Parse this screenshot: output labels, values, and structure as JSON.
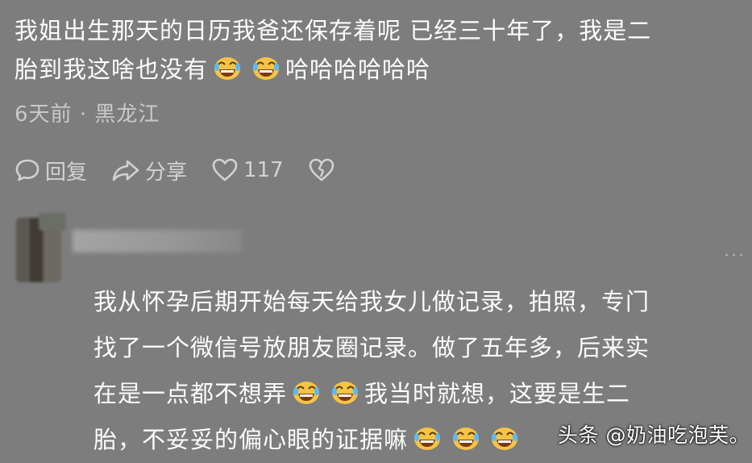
{
  "comment": {
    "text_line1": "我姐出生那天的日历我爸还保存着呢 已经三十年了，我是二",
    "text_line2_before": "胎到我这啥也没有",
    "text_line2_after": "哈哈哈哈哈哈",
    "time": "6天前",
    "separator": "·",
    "location": "黑龙江"
  },
  "actions": {
    "reply_label": "回复",
    "share_label": "分享",
    "like_count": "117"
  },
  "reply": {
    "line1": "我从怀孕后期开始每天给我女儿做记录，拍照，专门",
    "line2": "找了一个微信号放朋友圈记录。做了五年多，后来实",
    "line3_before": "在是一点都不想弄",
    "line3_after": "我当时就想，这要是生二",
    "line4": "胎，不妥妥的偏心眼的证据嘛",
    "more": "···"
  },
  "watermark": "头条 @奶油吃泡芙。",
  "colors": {
    "background": "#7d7d7d",
    "text": "#fdfdfd",
    "secondary": "#c9c9c9",
    "emoji_face": "#f6c445"
  }
}
